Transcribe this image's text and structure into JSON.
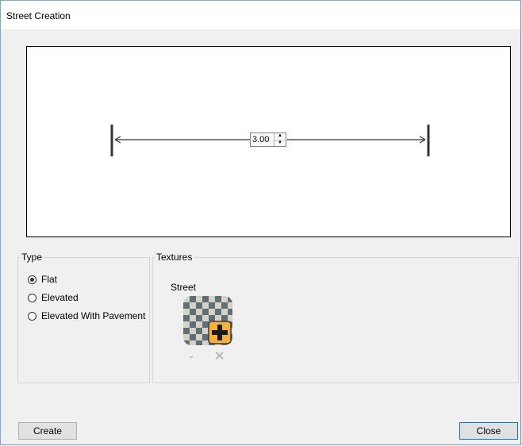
{
  "window": {
    "title": "Street Creation"
  },
  "preview": {
    "width_value": "3.00"
  },
  "type_group": {
    "label": "Type",
    "options": [
      {
        "label": "Flat",
        "checked": true
      },
      {
        "label": "Elevated",
        "checked": false
      },
      {
        "label": "Elevated With Pavement",
        "checked": false
      }
    ]
  },
  "textures_group": {
    "label": "Textures",
    "street_label": "Street",
    "icons": {
      "texture": "checker-texture-add-icon",
      "dropdown": "chevron-down-icon",
      "remove": "close-icon"
    },
    "colors": {
      "add_badge": "#f7b13b",
      "checker_dark": "#5f6f7a",
      "checker_light": "#d6d3c4"
    }
  },
  "buttons": {
    "create": "Create",
    "close": "Close"
  }
}
